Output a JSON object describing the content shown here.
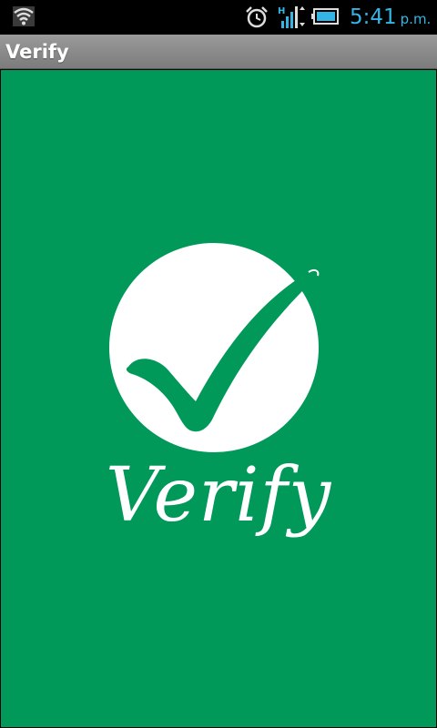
{
  "status_bar": {
    "time": "5:41",
    "ampm": "p.m.",
    "icons": [
      "wifi-icon",
      "alarm-icon",
      "signal-icon",
      "battery-icon"
    ],
    "accent_color": "#33b5e5"
  },
  "action_bar": {
    "title": "Verify"
  },
  "splash": {
    "background_color": "#00995a",
    "logo_icon": "checkmark-circle-icon",
    "wordmark": "Verify"
  }
}
